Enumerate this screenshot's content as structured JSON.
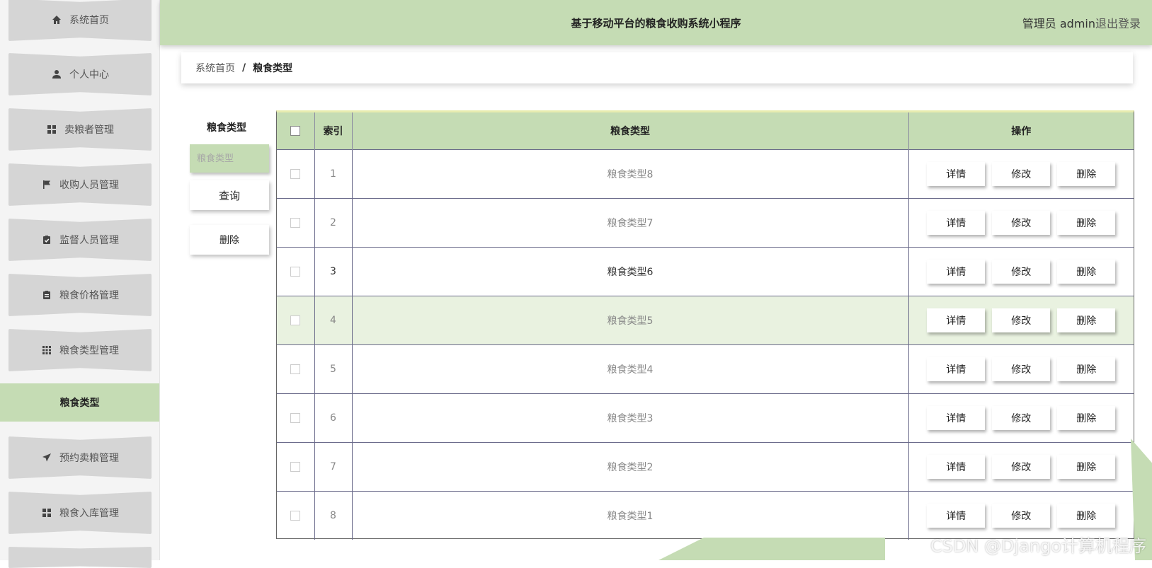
{
  "header": {
    "title": "基于移动平台的粮食收购系统小程序",
    "user_label": "管理员 admin",
    "logout_label": "退出登录"
  },
  "sidebar": {
    "items": [
      {
        "label": "系统首页",
        "icon": "home-icon"
      },
      {
        "label": "个人中心",
        "icon": "user-icon"
      },
      {
        "label": "卖粮者管理",
        "icon": "grid-icon"
      },
      {
        "label": "收购人员管理",
        "icon": "flag-icon"
      },
      {
        "label": "监督人员管理",
        "icon": "clipboard-check-icon"
      },
      {
        "label": "粮食价格管理",
        "icon": "clipboard-icon"
      },
      {
        "label": "粮食类型管理",
        "icon": "apps-icon"
      },
      {
        "label": "预约卖粮管理",
        "icon": "send-icon"
      },
      {
        "label": "粮食入库管理",
        "icon": "grid-icon"
      }
    ],
    "active_sub": "粮食类型"
  },
  "breadcrumb": {
    "home": "系统首页",
    "separator": "/",
    "current": "粮食类型"
  },
  "search": {
    "label": "粮食类型",
    "placeholder": "粮食类型",
    "query_button": "查询",
    "delete_button": "删除"
  },
  "table": {
    "headers": {
      "index": "索引",
      "name": "粮食类型",
      "actions": "操作"
    },
    "rows": [
      {
        "index": "1",
        "name": "粮食类型8"
      },
      {
        "index": "2",
        "name": "粮食类型7"
      },
      {
        "index": "3",
        "name": "粮食类型6"
      },
      {
        "index": "4",
        "name": "粮食类型5"
      },
      {
        "index": "5",
        "name": "粮食类型4"
      },
      {
        "index": "6",
        "name": "粮食类型3"
      },
      {
        "index": "7",
        "name": "粮食类型2"
      },
      {
        "index": "8",
        "name": "粮食类型1"
      }
    ],
    "actions": {
      "detail": "详情",
      "edit": "修改",
      "delete": "删除"
    }
  },
  "watermark": "CSDN @Django计算机程序",
  "colors": {
    "accent": "#c5dcb4",
    "sidebar_item": "#d5d5d5"
  }
}
